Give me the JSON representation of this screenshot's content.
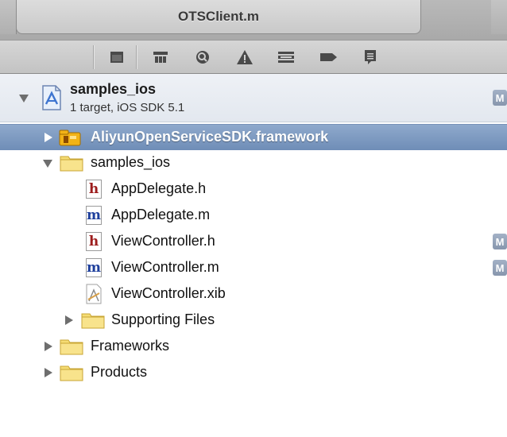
{
  "editor_tab": {
    "title": "OTSClient.m"
  },
  "toolbar": {
    "icons": [
      "project-navigator-icon",
      "symbol-navigator-icon",
      "search-navigator-icon",
      "issue-navigator-icon",
      "debug-navigator-icon",
      "breakpoint-navigator-icon",
      "log-navigator-icon"
    ]
  },
  "project": {
    "name": "samples_ios",
    "subtitle": "1 target, iOS SDK 5.1",
    "badge": "M"
  },
  "tree": [
    {
      "label": "AliyunOpenServiceSDK.framework",
      "kind": "framework",
      "selected": true
    },
    {
      "label": "samples_ios",
      "kind": "folder",
      "expanded": true
    },
    {
      "label": "AppDelegate.h",
      "kind": "h",
      "glyph": "h"
    },
    {
      "label": "AppDelegate.m",
      "kind": "m",
      "glyph": "m"
    },
    {
      "label": "ViewController.h",
      "kind": "h",
      "glyph": "h",
      "badge": "M"
    },
    {
      "label": "ViewController.m",
      "kind": "m",
      "glyph": "m",
      "badge": "M"
    },
    {
      "label": "ViewController.xib",
      "kind": "xib"
    },
    {
      "label": "Supporting Files",
      "kind": "folder"
    },
    {
      "label": "Frameworks",
      "kind": "folder"
    },
    {
      "label": "Products",
      "kind": "folder"
    }
  ],
  "colors": {
    "selection": "#7a97c0",
    "folder": "#f3d86a",
    "header_file": "#9c1c1c",
    "impl_file": "#1e3f9c",
    "badge": "#93a2b8"
  }
}
